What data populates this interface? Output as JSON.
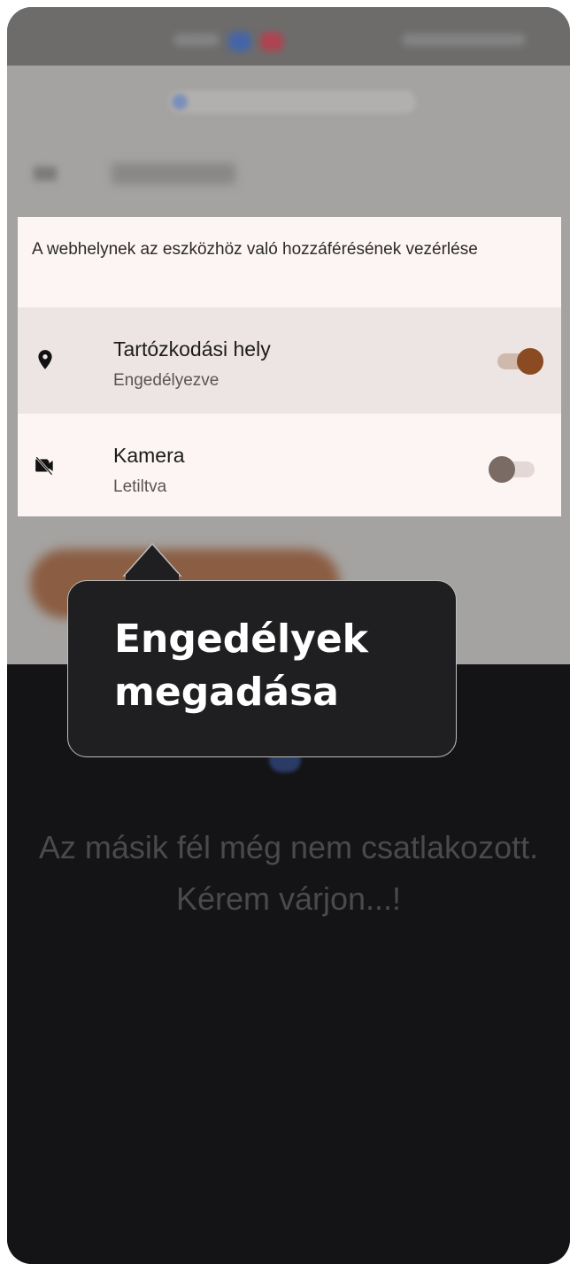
{
  "permissions": {
    "header": "A webhelynek az eszközhöz való hozzáférésének vezérlése",
    "items": [
      {
        "icon": "location-pin-icon",
        "title": "Tartózkodási hely",
        "status": "Engedélyezve",
        "enabled": true
      },
      {
        "icon": "camera-off-icon",
        "title": "Kamera",
        "status": "Letiltva",
        "enabled": false
      }
    ]
  },
  "tooltip": {
    "text": "Engedélyek megadása"
  },
  "waiting": {
    "text": "Az másik fél még nem csatlakozott. Kérem várjon...!"
  },
  "colors": {
    "toggle_on_thumb": "#8a4a22",
    "toggle_on_track": "#cfb9ad",
    "toggle_off_thumb": "#7a6b65",
    "toggle_off_track": "#e3d8d5",
    "dark_background": "#141416",
    "tooltip_background": "#1f1f21"
  }
}
